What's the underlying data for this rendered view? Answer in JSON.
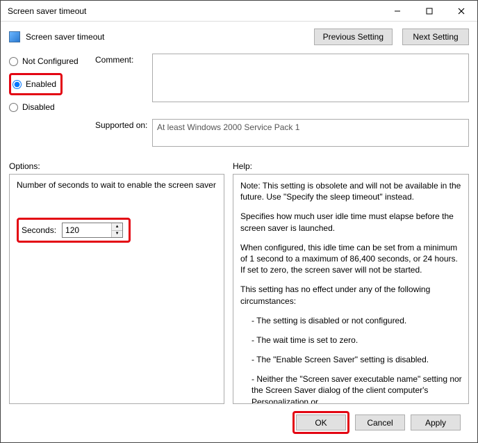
{
  "window": {
    "title": "Screen saver timeout"
  },
  "header": {
    "title": "Screen saver timeout",
    "prev": "Previous Setting",
    "next": "Next Setting"
  },
  "state": {
    "not_configured": "Not Configured",
    "enabled": "Enabled",
    "disabled": "Disabled",
    "selected": "enabled"
  },
  "fields": {
    "comment_label": "Comment:",
    "comment_value": "",
    "supported_label": "Supported on:",
    "supported_value": "At least Windows 2000 Service Pack 1"
  },
  "labels": {
    "options": "Options:",
    "help": "Help:"
  },
  "options": {
    "desc": "Number of seconds to wait to enable the screen saver",
    "seconds_label": "Seconds:",
    "seconds_value": "120"
  },
  "help": {
    "p1": "Note: This setting is obsolete and will not be available in the future. Use \"Specify the sleep timeout\" instead.",
    "p2": "Specifies how much user idle time must elapse before the screen saver is launched.",
    "p3": "When configured, this idle time can be set from a minimum of 1 second to a maximum of 86,400 seconds, or 24 hours. If set to zero, the screen saver will not be started.",
    "p4": "This setting has no effect under any of the following circumstances:",
    "b1": "- The setting is disabled or not configured.",
    "b2": "- The wait time is set to zero.",
    "b3": "- The \"Enable Screen Saver\" setting is disabled.",
    "b4": "- Neither the \"Screen saver executable name\" setting nor the Screen Saver dialog of the client computer's Personalization or"
  },
  "footer": {
    "ok": "OK",
    "cancel": "Cancel",
    "apply": "Apply"
  }
}
